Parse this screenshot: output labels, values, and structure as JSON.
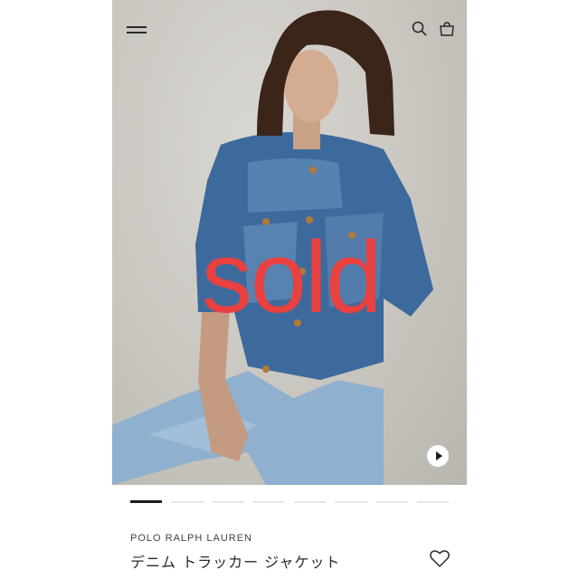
{
  "header": {
    "menu_icon": "hamburger-menu-icon",
    "search_icon": "search-icon",
    "bag_icon": "shopping-bag-icon"
  },
  "hero": {
    "overlay_text": "sold",
    "overlay_color": "#e8413f",
    "play_icon": "play-icon"
  },
  "carousel": {
    "total_slides": 8,
    "active_index": 0
  },
  "product": {
    "brand": "POLO RALPH LAUREN",
    "name": "デニム トラッカー ジャケット",
    "wishlist_icon": "heart-icon"
  }
}
